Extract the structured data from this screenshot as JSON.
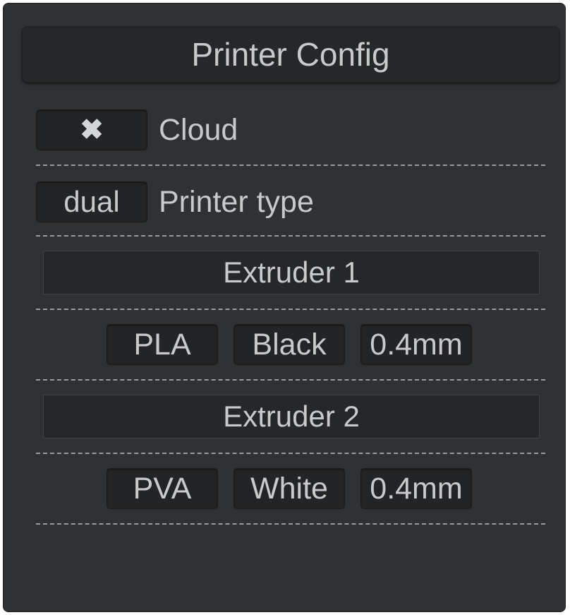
{
  "panel": {
    "title": "Printer Config"
  },
  "cloud": {
    "toggle_icon": "close-icon",
    "toggle_glyph": "✖",
    "label": "Cloud"
  },
  "printer_type": {
    "value": "dual",
    "label": "Printer type"
  },
  "extruder1": {
    "title": "Extruder 1",
    "material": "PLA",
    "color": "Black",
    "nozzle": "0.4mm"
  },
  "extruder2": {
    "title": "Extruder 2",
    "material": "PVA",
    "color": "White",
    "nozzle": "0.4mm"
  }
}
